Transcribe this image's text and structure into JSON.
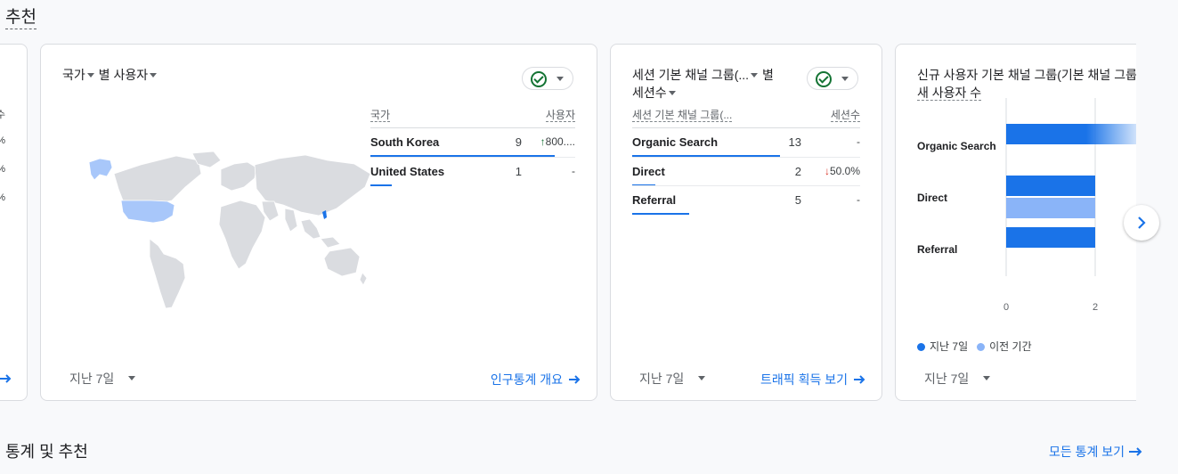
{
  "recommendations": {
    "title": "추천",
    "prev_card": {
      "rows": [
        "수",
        "%",
        "%",
        "%"
      ]
    },
    "country_card": {
      "dim_label": "국가",
      "middle": "별",
      "metric_label": "사용자",
      "table": {
        "headers": [
          "국가",
          "사용자"
        ],
        "rows": [
          {
            "name": "South Korea",
            "value": "9",
            "change": "800....",
            "trend": "up",
            "share": 0.9
          },
          {
            "name": "United States",
            "value": "1",
            "change": "-",
            "trend": "none",
            "share": 0.1
          }
        ]
      },
      "date_range": "지난 7일",
      "link": "인구통계 개요"
    },
    "channel_card": {
      "dim_label": "세션 기본 채널 그룹(...",
      "middle": "별",
      "metric_label": "세션수",
      "table": {
        "headers": [
          "세션 기본 채널 그룹(...",
          "세션수"
        ],
        "rows": [
          {
            "name": "Organic Search",
            "value": "13",
            "change": "-",
            "trend": "none",
            "share": 0.65
          },
          {
            "name": "Direct",
            "value": "2",
            "change": "50.0%",
            "trend": "down",
            "share": 0.1
          },
          {
            "name": "Referral",
            "value": "5",
            "change": "-",
            "trend": "none",
            "share": 0.25
          }
        ]
      },
      "date_range": "지난 7일",
      "link": "트래픽 획득 보기"
    },
    "newuser_card": {
      "title": "신규 사용자 기본 채널 그룹(기본 채널 그룹)",
      "metric_label": "새 사용자 수",
      "date_range": "지난 7일",
      "legend": [
        {
          "label": "지난 7일",
          "color": "#1a73e8"
        },
        {
          "label": "이전 기간",
          "color": "#8ab4f8"
        }
      ]
    }
  },
  "chart_data": {
    "type": "bar",
    "orientation": "horizontal",
    "categories": [
      "Organic Search",
      "Direct",
      "Referral"
    ],
    "series": [
      {
        "name": "지난 7일",
        "values": [
          3,
          2,
          2
        ]
      },
      {
        "name": "이전 기간",
        "values": [
          null,
          2,
          null
        ]
      }
    ],
    "xticks": [
      "0",
      "2"
    ],
    "xlim": [
      0,
      3
    ],
    "colors": [
      "#1a73e8",
      "#8ab4f8"
    ]
  },
  "stats_section": {
    "title": "통계 및 추천",
    "link": "모든 통계 보기"
  }
}
